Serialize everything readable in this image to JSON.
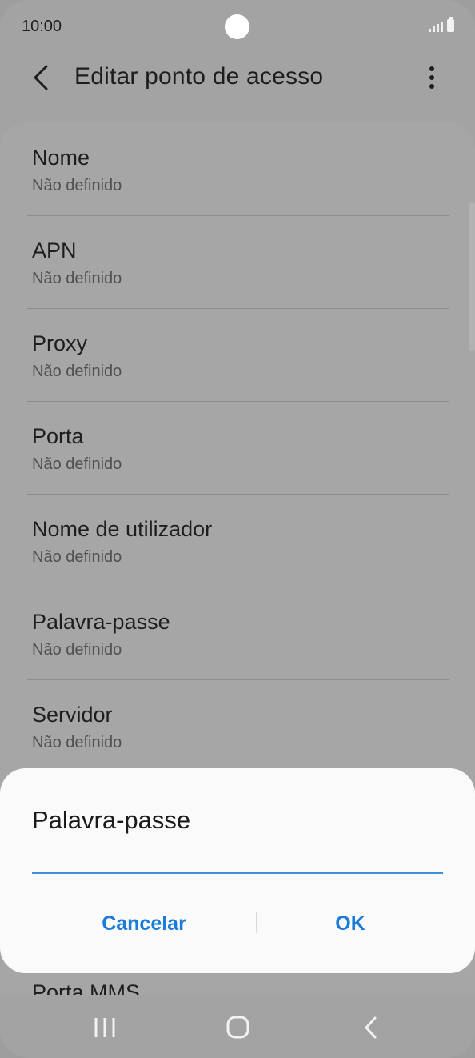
{
  "status_bar": {
    "time": "10:00"
  },
  "header": {
    "title": "Editar ponto de acesso"
  },
  "settings_list": [
    {
      "title": "Nome",
      "value": "Não definido"
    },
    {
      "title": "APN",
      "value": "Não definido"
    },
    {
      "title": "Proxy",
      "value": "Não definido"
    },
    {
      "title": "Porta",
      "value": "Não definido"
    },
    {
      "title": "Nome de utilizador",
      "value": "Não definido"
    },
    {
      "title": "Palavra-passe",
      "value": "Não definido"
    },
    {
      "title": "Servidor",
      "value": "Não definido"
    }
  ],
  "partial_item": "Porta MMS",
  "dialog": {
    "title": "Palavra-passe",
    "input_value": "",
    "cancel_label": "Cancelar",
    "ok_label": "OK",
    "accent_color": "#1a7bd8"
  },
  "icons": {
    "back": "back-arrow-icon",
    "more": "more-options-icon",
    "nav_recents": "recents-icon",
    "nav_home": "home-icon",
    "nav_back": "nav-back-icon"
  }
}
